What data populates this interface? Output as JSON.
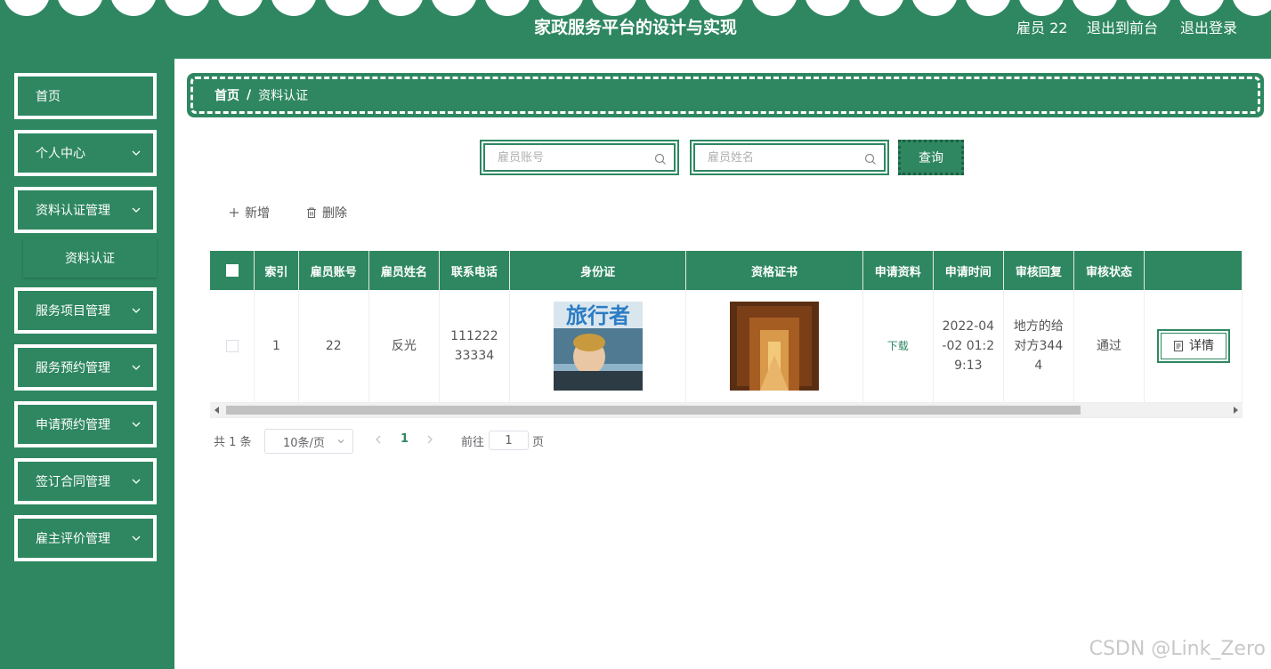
{
  "header": {
    "title": "家政服务平台的设计与实现",
    "user": "雇员 22",
    "to_front": "退出到前台",
    "logout": "退出登录"
  },
  "sidebar": {
    "items": [
      {
        "label": "首页"
      },
      {
        "label": "个人中心"
      },
      {
        "label": "资料认证管理"
      },
      {
        "label": "服务项目管理"
      },
      {
        "label": "服务预约管理"
      },
      {
        "label": "申请预约管理"
      },
      {
        "label": "签订合同管理"
      },
      {
        "label": "雇主评价管理"
      }
    ],
    "sub_item": "资料认证"
  },
  "breadcrumb": {
    "home": "首页",
    "sep": "/",
    "current": "资料认证"
  },
  "search": {
    "account_placeholder": "雇员账号",
    "name_placeholder": "雇员姓名",
    "query_label": "查询"
  },
  "actions": {
    "add": "新增",
    "delete": "删除"
  },
  "table": {
    "headers": [
      "索引",
      "雇员账号",
      "雇员姓名",
      "联系电话",
      "身份证",
      "资格证书",
      "申请资料",
      "申请时间",
      "审核回复",
      "审核状态"
    ],
    "row": {
      "index": "1",
      "account": "22",
      "name": "反光",
      "phone": "11122233334",
      "id_card_image_text": "旅行者",
      "apply_material": "下载",
      "apply_time": "2022-04-02 01:29:13",
      "reply": "地方的给对方3444",
      "status": "通过",
      "detail": "详情"
    }
  },
  "pager": {
    "total": "共 1 条",
    "page_size": "10条/页",
    "current_page": "1",
    "goto_label": "前往",
    "goto_value": "1",
    "page_unit": "页"
  },
  "watermark": "CSDN @Link_Zero",
  "colors": {
    "primary": "#2e8760"
  }
}
